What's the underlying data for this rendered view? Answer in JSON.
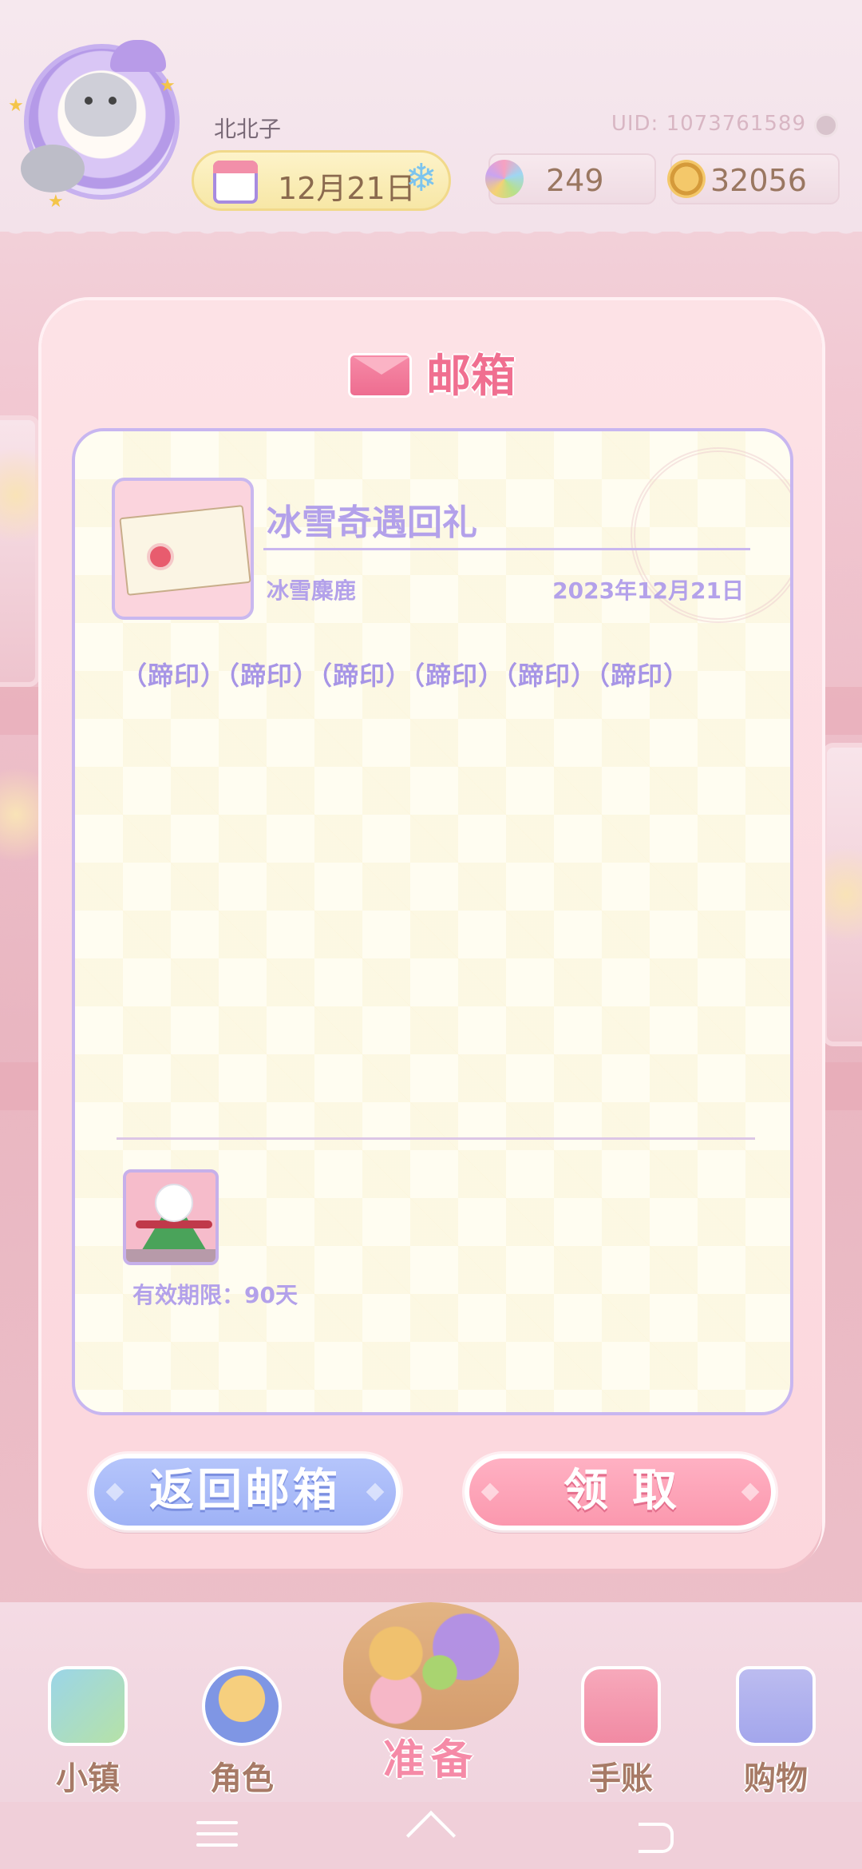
{
  "header": {
    "username": "北北子",
    "uid": "UID: 1073761589",
    "date": "12月21日",
    "gems": "249",
    "coins": "32056",
    "icons": {
      "calendar": "calendar-icon",
      "snow": "snowflake-icon",
      "gem": "rainbow-gem-icon",
      "coin": "coin-icon",
      "copy": "copy-icon"
    }
  },
  "modal": {
    "title": "邮箱",
    "mail": {
      "subject": "冰雪奇遇回礼",
      "sender": "冰雪麋鹿",
      "date": "2023年12月21日",
      "body": "（蹄印）（蹄印）（蹄印）（蹄印）（蹄印）（蹄印）"
    },
    "reward": {
      "item_icon": "christmas-tree-snowman-icon",
      "expiry": "有效期限：90天"
    },
    "buttons": {
      "back": "返回邮箱",
      "claim": "领取"
    }
  },
  "bottom_nav": {
    "items": [
      {
        "label": "小镇",
        "icon": "map-icon"
      },
      {
        "label": "角色",
        "icon": "character-icon"
      },
      {
        "label": "准备",
        "icon": "basket-icon"
      },
      {
        "label": "手账",
        "icon": "diary-icon"
      },
      {
        "label": "购物",
        "icon": "shopping-bag-icon"
      }
    ]
  },
  "colors": {
    "accent_pink": "#f06f90",
    "accent_lavender": "#b3a1ea",
    "button_blue": "#9fb2f6",
    "button_pink": "#fb98ae"
  }
}
